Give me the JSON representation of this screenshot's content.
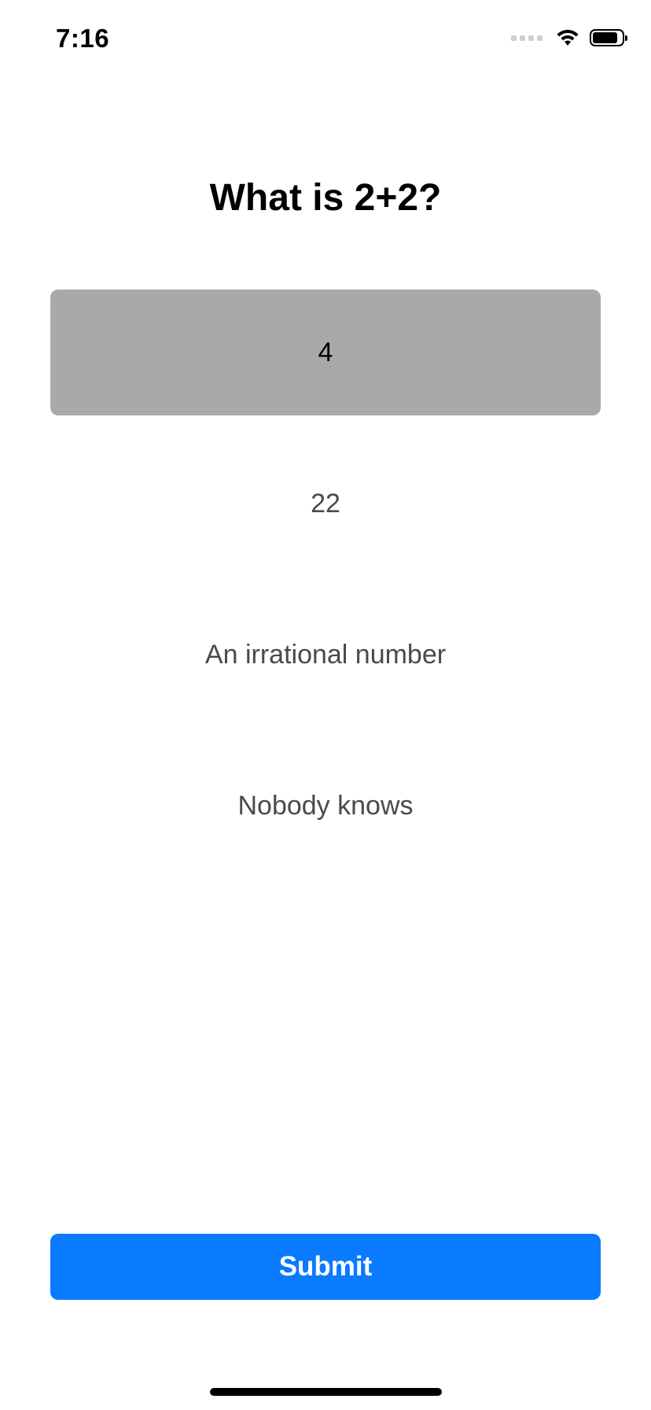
{
  "status_bar": {
    "time": "7:16",
    "icons": [
      "cellular-signal-icon",
      "wifi-icon",
      "battery-icon"
    ],
    "battery_level": 0.85
  },
  "question": {
    "title": "What is 2+2?"
  },
  "answers": [
    {
      "label": "4",
      "selected": true
    },
    {
      "label": "22",
      "selected": false
    },
    {
      "label": "An irrational number",
      "selected": false
    },
    {
      "label": "Nobody knows",
      "selected": false
    }
  ],
  "submit": {
    "label": "Submit"
  },
  "colors": {
    "accent": "#0a7aff",
    "selected_background": "#a9a9a9",
    "unselected_text": "#4a4a4a"
  }
}
